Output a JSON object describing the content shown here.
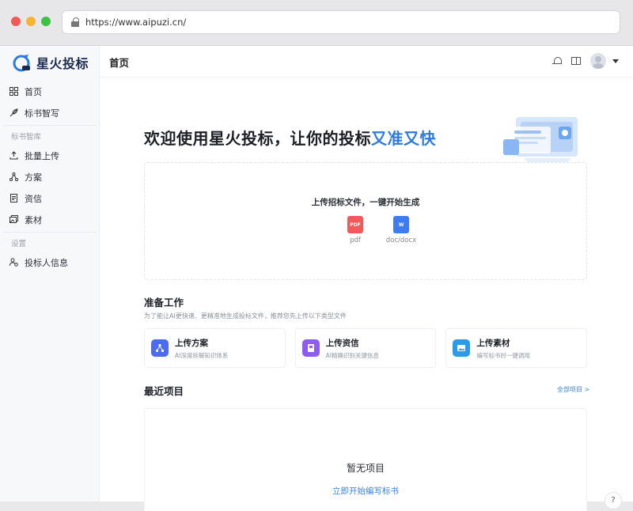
{
  "browser": {
    "url": "https://www.aipuzi.cn/"
  },
  "sidebar": {
    "logo_text": "星火投标",
    "items": [
      {
        "label": "首页",
        "icon": "grid-icon"
      },
      {
        "label": "标书智写",
        "icon": "quill-icon"
      }
    ],
    "section_library": "标书智库",
    "library_items": [
      {
        "label": "批量上传",
        "icon": "upload-icon"
      },
      {
        "label": "方案",
        "icon": "network-icon"
      },
      {
        "label": "资信",
        "icon": "document-icon"
      },
      {
        "label": "素材",
        "icon": "image-stack-icon"
      }
    ],
    "section_settings": "设置",
    "settings_items": [
      {
        "label": "投标人信息",
        "icon": "user-settings-icon"
      }
    ]
  },
  "header": {
    "title": "首页"
  },
  "main": {
    "welcome_prefix": "欢迎使用星火投标，让你的投标",
    "welcome_accent": "又准又快",
    "upload": {
      "title": "上传招标文件，一键开始生成",
      "pdf_label": "pdf",
      "doc_label": "doc/docx"
    },
    "prep": {
      "title": "准备工作",
      "subtitle": "为了能让AI更快速、更精准地生成投标文件，推荐您先上传以下类型文件",
      "cards": [
        {
          "title": "上传方案",
          "desc": "AI深度拆解知识体系"
        },
        {
          "title": "上传资信",
          "desc": "AI精确识别关键信息"
        },
        {
          "title": "上传素材",
          "desc": "编写标书时一键调用"
        }
      ]
    },
    "recent": {
      "title": "最近项目",
      "all_link": "全部项目 >",
      "empty_title": "暂无项目",
      "empty_link": "立即开始编写标书"
    }
  },
  "colors": {
    "accent": "#2b7be0",
    "sidebar_bg": "#f7f8fa"
  }
}
